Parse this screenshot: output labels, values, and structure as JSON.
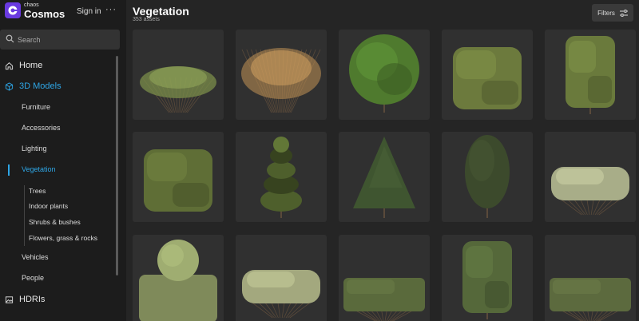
{
  "brand": {
    "top": "chaos",
    "name": "Cosmos"
  },
  "header": {
    "signin_label": "Sign in",
    "more_label": "···",
    "title": "Vegetation",
    "count": "353 assets",
    "filters_label": "Filters"
  },
  "search": {
    "placeholder": "Search"
  },
  "nav": {
    "home": "Home",
    "models": "3D Models",
    "furniture": "Furniture",
    "accessories": "Accessories",
    "lighting": "Lighting",
    "vegetation": "Vegetation",
    "trees": "Trees",
    "indoor": "Indoor plants",
    "shrubs": "Shrubs & bushes",
    "flowers": "Flowers, grass & rocks",
    "vehicles": "Vehicles",
    "people": "People",
    "hdris": "HDRIs"
  },
  "assets": [
    {
      "kind": "grass-bush",
      "color": "#7a8c4a"
    },
    {
      "kind": "dry-bush",
      "color": "#b58a52"
    },
    {
      "kind": "round-tree",
      "color": "#4f7a2e"
    },
    {
      "kind": "box-hedge",
      "color": "#6c7a3d"
    },
    {
      "kind": "tall-box-hedge",
      "color": "#6a7a3c"
    },
    {
      "kind": "box-hedge",
      "color": "#5f6e36"
    },
    {
      "kind": "topiary-spiral",
      "color": "#4e5f2c"
    },
    {
      "kind": "conifer",
      "color": "#3f5530"
    },
    {
      "kind": "oval-tree",
      "color": "#3c4a2c"
    },
    {
      "kind": "flower-hedge",
      "color": "#a8ad88"
    },
    {
      "kind": "ball-hedge",
      "color": "#7f8a5a"
    },
    {
      "kind": "flower-hedge",
      "color": "#a3a87e"
    },
    {
      "kind": "low-hedge",
      "color": "#5a6a3c"
    },
    {
      "kind": "tall-box-hedge",
      "color": "#55683a"
    },
    {
      "kind": "low-hedge",
      "color": "#5c6a3e"
    }
  ]
}
